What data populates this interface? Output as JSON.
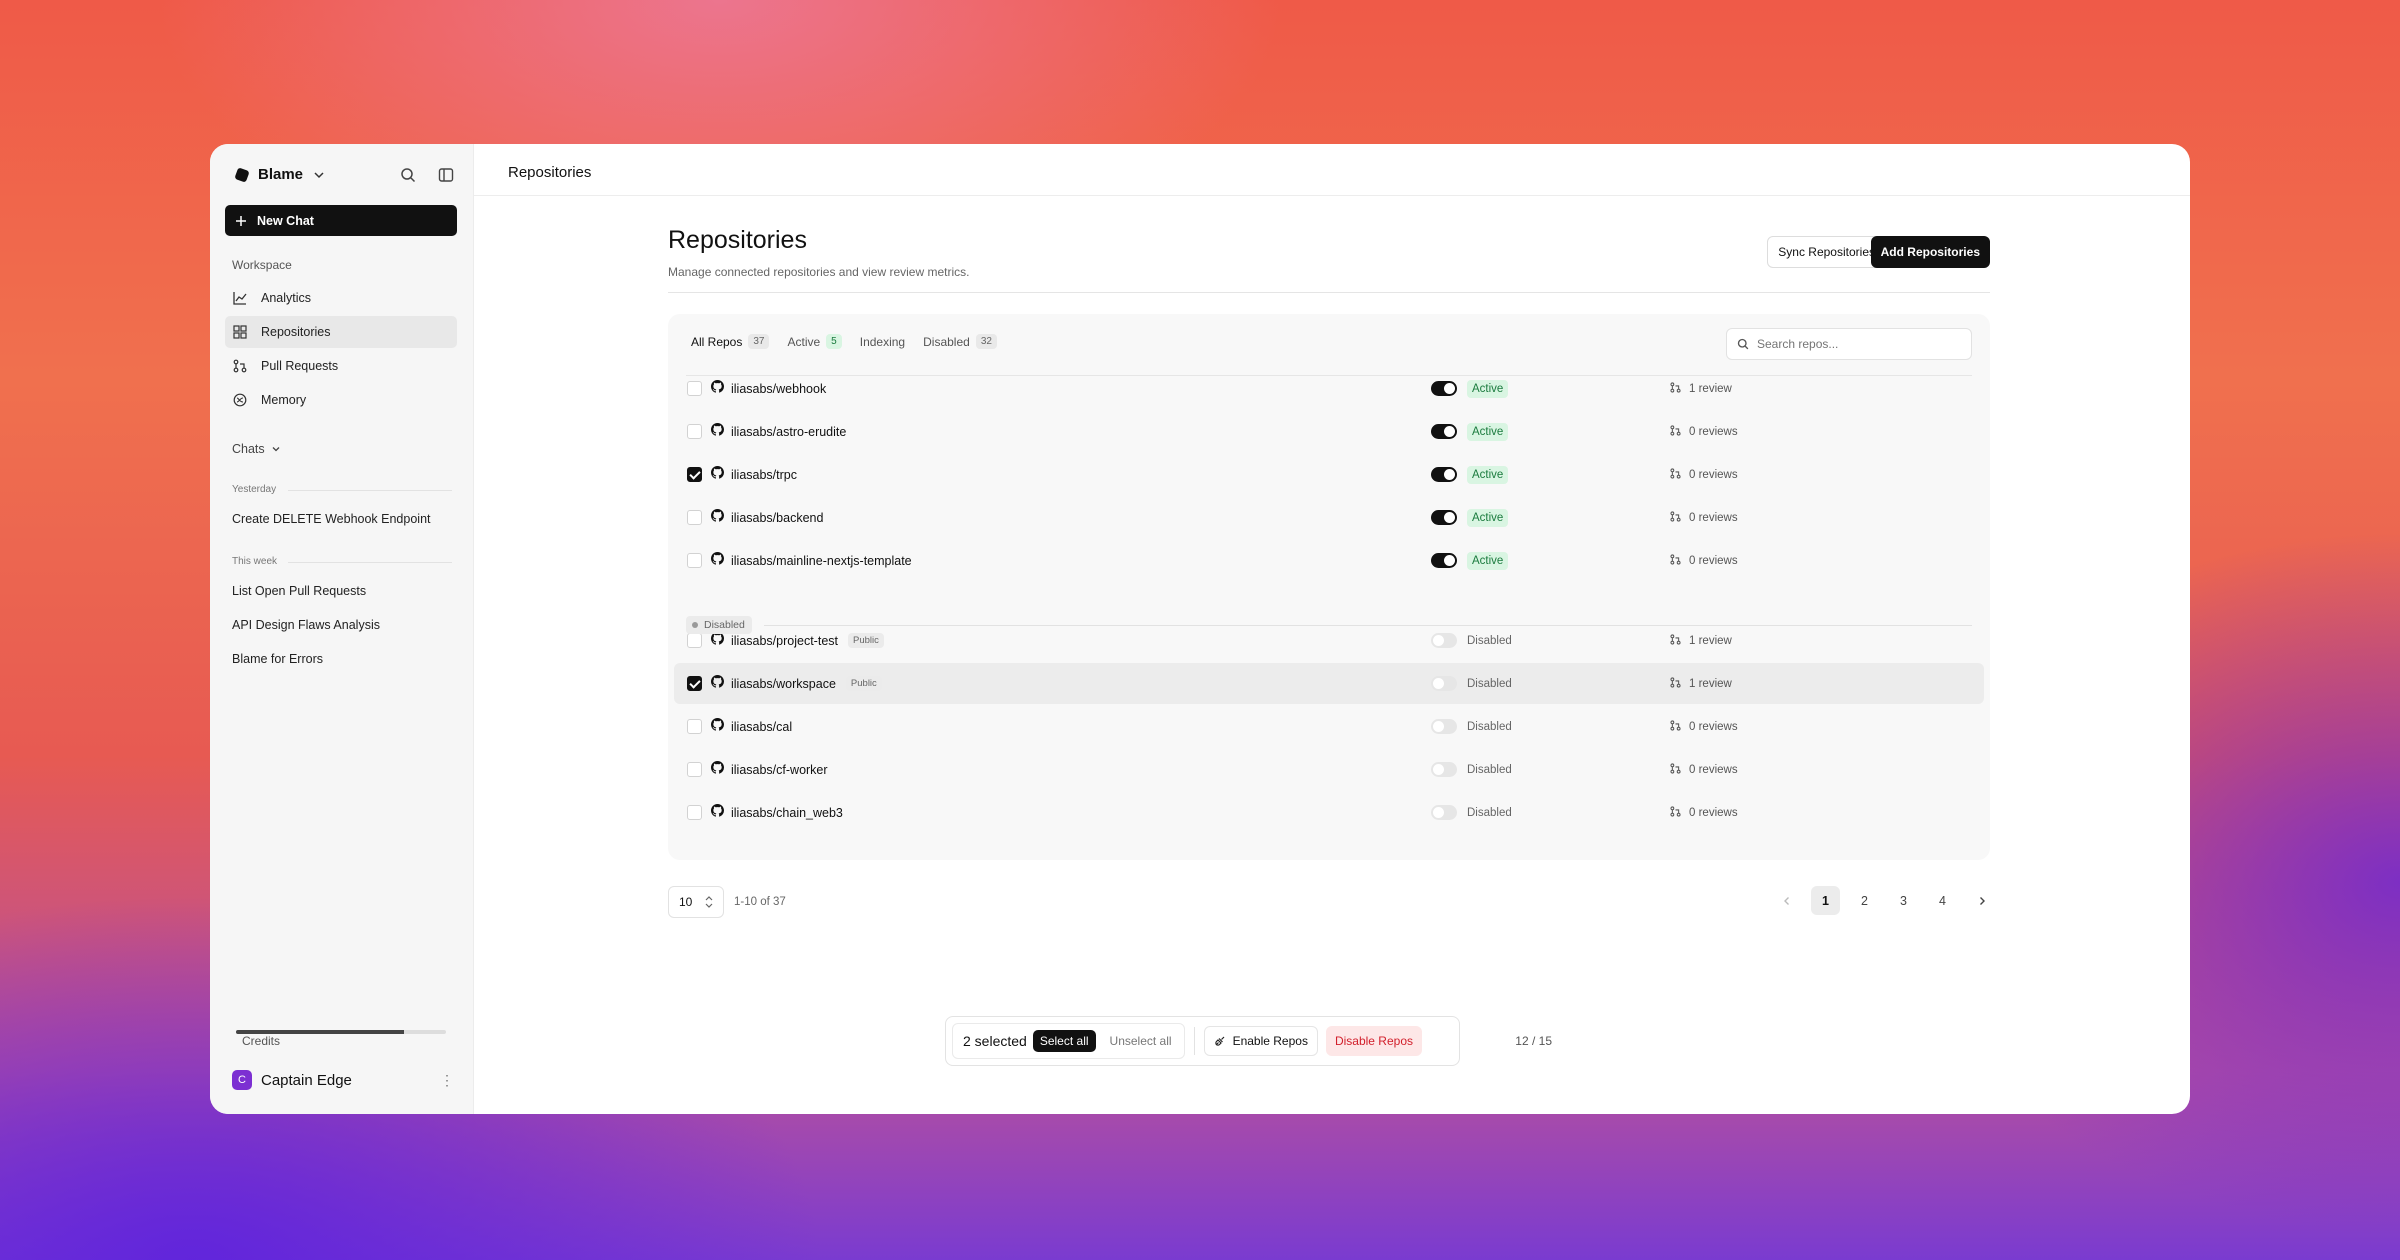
{
  "sidebar": {
    "workspace_name": "Blame",
    "new_chat_label": "New Chat",
    "workspace_label": "Workspace",
    "nav": [
      {
        "label": "Analytics",
        "icon": "chart-line-icon"
      },
      {
        "label": "Repositories",
        "icon": "grid-icon",
        "active": true
      },
      {
        "label": "Pull Requests",
        "icon": "pull-request-icon"
      },
      {
        "label": "Memory",
        "icon": "brain-icon"
      }
    ],
    "chats_label": "Chats",
    "groups": [
      {
        "label": "Yesterday",
        "items": [
          "Create DELETE Webhook Endpoint"
        ]
      },
      {
        "label": "This week",
        "items": [
          "List Open Pull Requests",
          "API Design Flaws Analysis",
          "Blame for Errors"
        ]
      }
    ],
    "credits": {
      "label": "Credits",
      "value": "12 / 15",
      "used_fraction": 0.8
    },
    "user": {
      "name": "Captain Edge",
      "initial": "C"
    }
  },
  "topbar": {
    "breadcrumb": "Repositories"
  },
  "header": {
    "title": "Repositories",
    "subtitle": "Manage connected repositories and view review metrics.",
    "sync_label": "Sync Repositories",
    "add_label": "Add Repositories"
  },
  "tabs": [
    {
      "label": "All Repos",
      "count": "37",
      "active": true
    },
    {
      "label": "Active",
      "count": "5"
    },
    {
      "label": "Indexing",
      "count": ""
    },
    {
      "label": "Disabled",
      "count": "32"
    }
  ],
  "search": {
    "placeholder": "Search repos..."
  },
  "disabled_section_label": "Disabled",
  "repos": [
    {
      "name": "iliasabs/webhook",
      "public": "",
      "checked": false,
      "enabled": true,
      "status": "Active",
      "reviews": "1 review"
    },
    {
      "name": "iliasabs/astro-erudite",
      "public": "",
      "checked": false,
      "enabled": true,
      "status": "Active",
      "reviews": "0 reviews"
    },
    {
      "name": "iliasabs/trpc",
      "public": "",
      "checked": true,
      "enabled": true,
      "status": "Active",
      "reviews": "0 reviews"
    },
    {
      "name": "iliasabs/backend",
      "public": "",
      "checked": false,
      "enabled": true,
      "status": "Active",
      "reviews": "0 reviews"
    },
    {
      "name": "iliasabs/mainline-nextjs-template",
      "public": "",
      "checked": false,
      "enabled": true,
      "status": "Active",
      "reviews": "0 reviews"
    },
    {
      "name": "iliasabs/project-test",
      "public": "Public",
      "checked": false,
      "enabled": false,
      "status": "Disabled",
      "reviews": "1 review"
    },
    {
      "name": "iliasabs/workspace",
      "public": "Public",
      "checked": true,
      "enabled": false,
      "status": "Disabled",
      "reviews": "1 review"
    },
    {
      "name": "iliasabs/cal",
      "public": "",
      "checked": false,
      "enabled": false,
      "status": "Disabled",
      "reviews": "0 reviews"
    },
    {
      "name": "iliasabs/cf-worker",
      "public": "",
      "checked": false,
      "enabled": false,
      "status": "Disabled",
      "reviews": "0 reviews"
    },
    {
      "name": "iliasabs/chain_web3",
      "public": "",
      "checked": false,
      "enabled": false,
      "status": "Disabled",
      "reviews": "0 reviews"
    }
  ],
  "pagination": {
    "page_size": "10",
    "range": "1-10 of 37",
    "pages": [
      "1",
      "2",
      "3",
      "4"
    ],
    "current": "1"
  },
  "action_bar": {
    "selected": "2 selected",
    "select_all": "Select all",
    "unselect_all": "Unselect all",
    "enable": "Enable Repos",
    "disable": "Disable Repos"
  }
}
